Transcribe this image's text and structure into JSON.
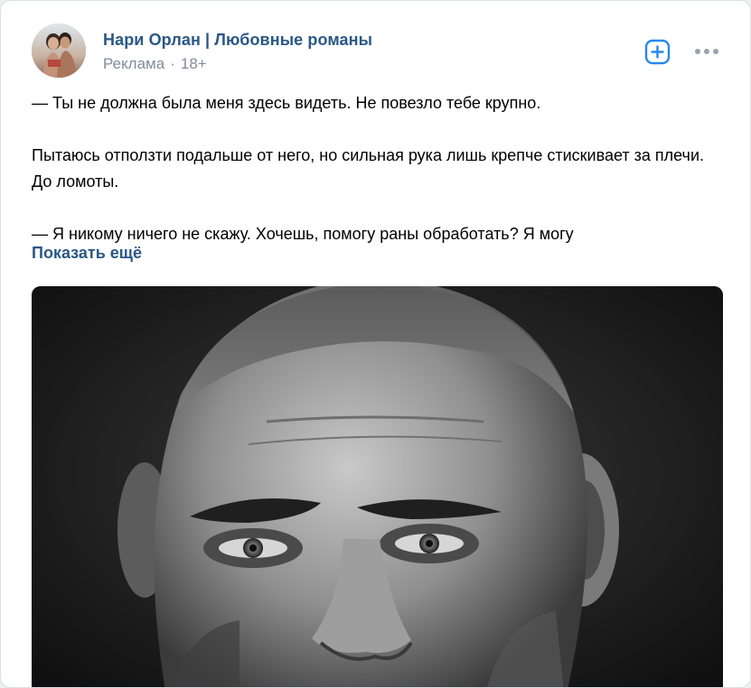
{
  "post": {
    "author": "Нари Орлан | Любовные романы",
    "meta_label": "Реклама",
    "meta_separator": "·",
    "age_rating": "18+",
    "paragraphs": [
      "— Ты не должна была меня здесь видеть. Не повезло тебе крупно.",
      "Пытаюсь отползти подальше от него, но сильная рука лишь крепче стискивает за плечи. До ломоты.",
      "— Я никому ничего не скажу. Хочешь, помогу раны обработать? Я могу"
    ],
    "show_more": "Показать ещё"
  },
  "icons": {
    "avatar": "avatar-image",
    "add": "plus-square-icon",
    "more": "more-dots-icon",
    "photo": "man-portrait-image"
  },
  "colors": {
    "link": "#2a5885",
    "meta": "#818c99",
    "accent": "#2688eb"
  }
}
